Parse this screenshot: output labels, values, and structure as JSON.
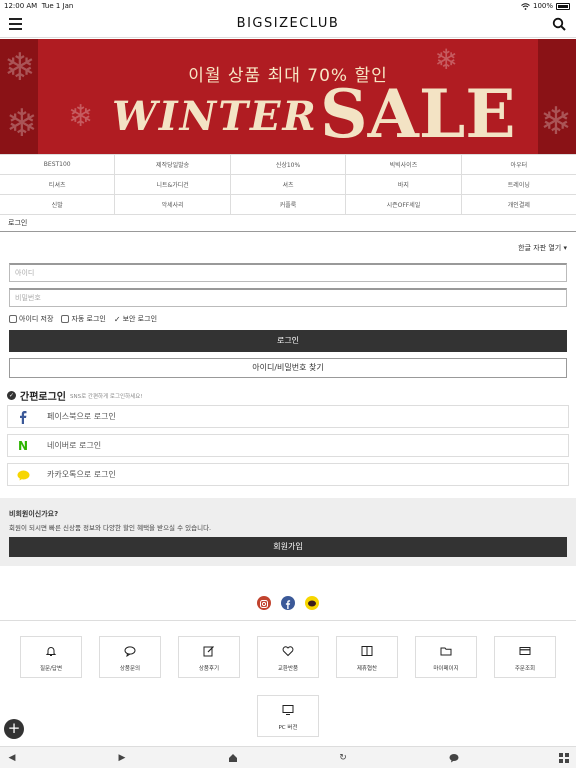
{
  "status": {
    "time": "12:00 AM",
    "date": "Tue 1 Jan",
    "battery": "100%"
  },
  "header": {
    "brand": "BIGSIZECLUB"
  },
  "banner": {
    "line1": "이월 상품  최대 70% 할인",
    "winter": "WINTER",
    "sale": "SALE"
  },
  "categories": [
    [
      "BEST100",
      "제작당일발송",
      "신상10%",
      "빅빅사이즈",
      "아우터"
    ],
    [
      "티셔츠",
      "니트&가디건",
      "셔츠",
      "바지",
      "트레이닝"
    ],
    [
      "신발",
      "악세사리",
      "커플룩",
      "시즌OFF세일",
      "개인결제"
    ]
  ],
  "login": {
    "section_title": "로그인",
    "language": "한글 자판 열기 ▾",
    "id_placeholder": "아이디",
    "pw_placeholder": "비밀번호",
    "save_id": "아이디 저장",
    "auto_login": "자동 로그인",
    "secure_login": "보안 로그인",
    "login_button": "로그인",
    "find_button": "아이디/비밀번호 찾기"
  },
  "easy_login": {
    "title": "간편로그인",
    "subtitle": "SNS로 간편하게 로그인하세요!",
    "facebook": "페이스북으로 로그인",
    "naver": "네이버로 로그인",
    "kakao": "카카오톡으로 로그인"
  },
  "join": {
    "question": "비회원이신가요?",
    "description": "회원이 되시면 빠른 신상품 정보와 다양한 할인 혜택을 받으실 수 있습니다.",
    "button": "회원가입"
  },
  "footer": {
    "tiles": [
      "질문/답변",
      "상품문의",
      "상품후기",
      "교환반품",
      "제휴협찬",
      "마이페이지",
      "주문조회"
    ],
    "pc_version": "PC 버전"
  },
  "colors": {
    "banner": "#b01c22",
    "dark_button": "#333333",
    "facebook": "#3b5998",
    "naver": "#2db400",
    "kakao": "#f7d600"
  }
}
